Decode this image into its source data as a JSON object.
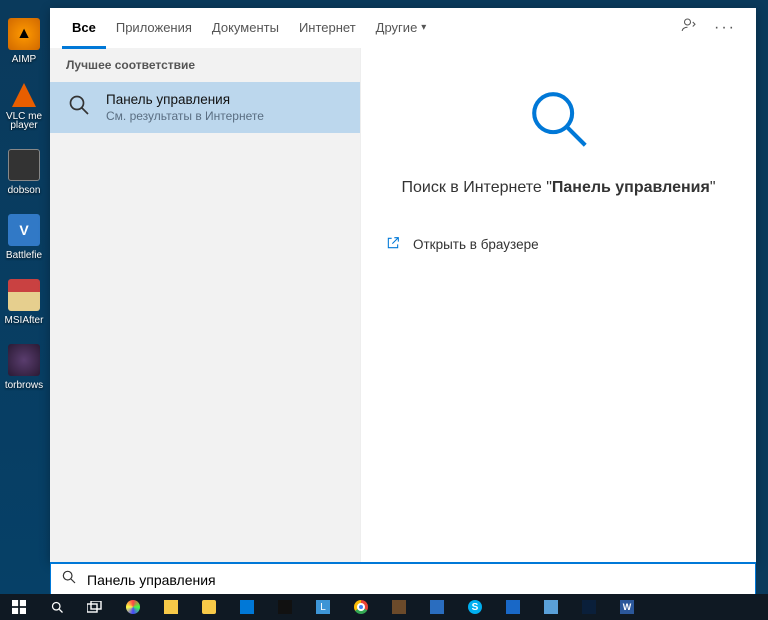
{
  "desktop": {
    "icons": [
      {
        "label": "AIMP"
      },
      {
        "label": "VLC me"
      },
      {
        "label": "player"
      },
      {
        "label": "dobson"
      },
      {
        "label": "Battlefie"
      },
      {
        "label": "MSIAfter"
      },
      {
        "label": "torbrows"
      }
    ]
  },
  "tabs": {
    "items": [
      {
        "label": "Все"
      },
      {
        "label": "Приложения"
      },
      {
        "label": "Документы"
      },
      {
        "label": "Интернет"
      },
      {
        "label": "Другие"
      }
    ]
  },
  "results": {
    "section_header": "Лучшее соответствие",
    "list": [
      {
        "title": "Панель управления",
        "subtitle": "См. результаты в Интернете"
      }
    ]
  },
  "preview": {
    "headline_prefix": "Поиск в Интернете \"",
    "headline_query": "Панель управления",
    "headline_suffix": "\"",
    "action_label": "Открыть в браузере"
  },
  "search": {
    "value": "Панель управления"
  }
}
